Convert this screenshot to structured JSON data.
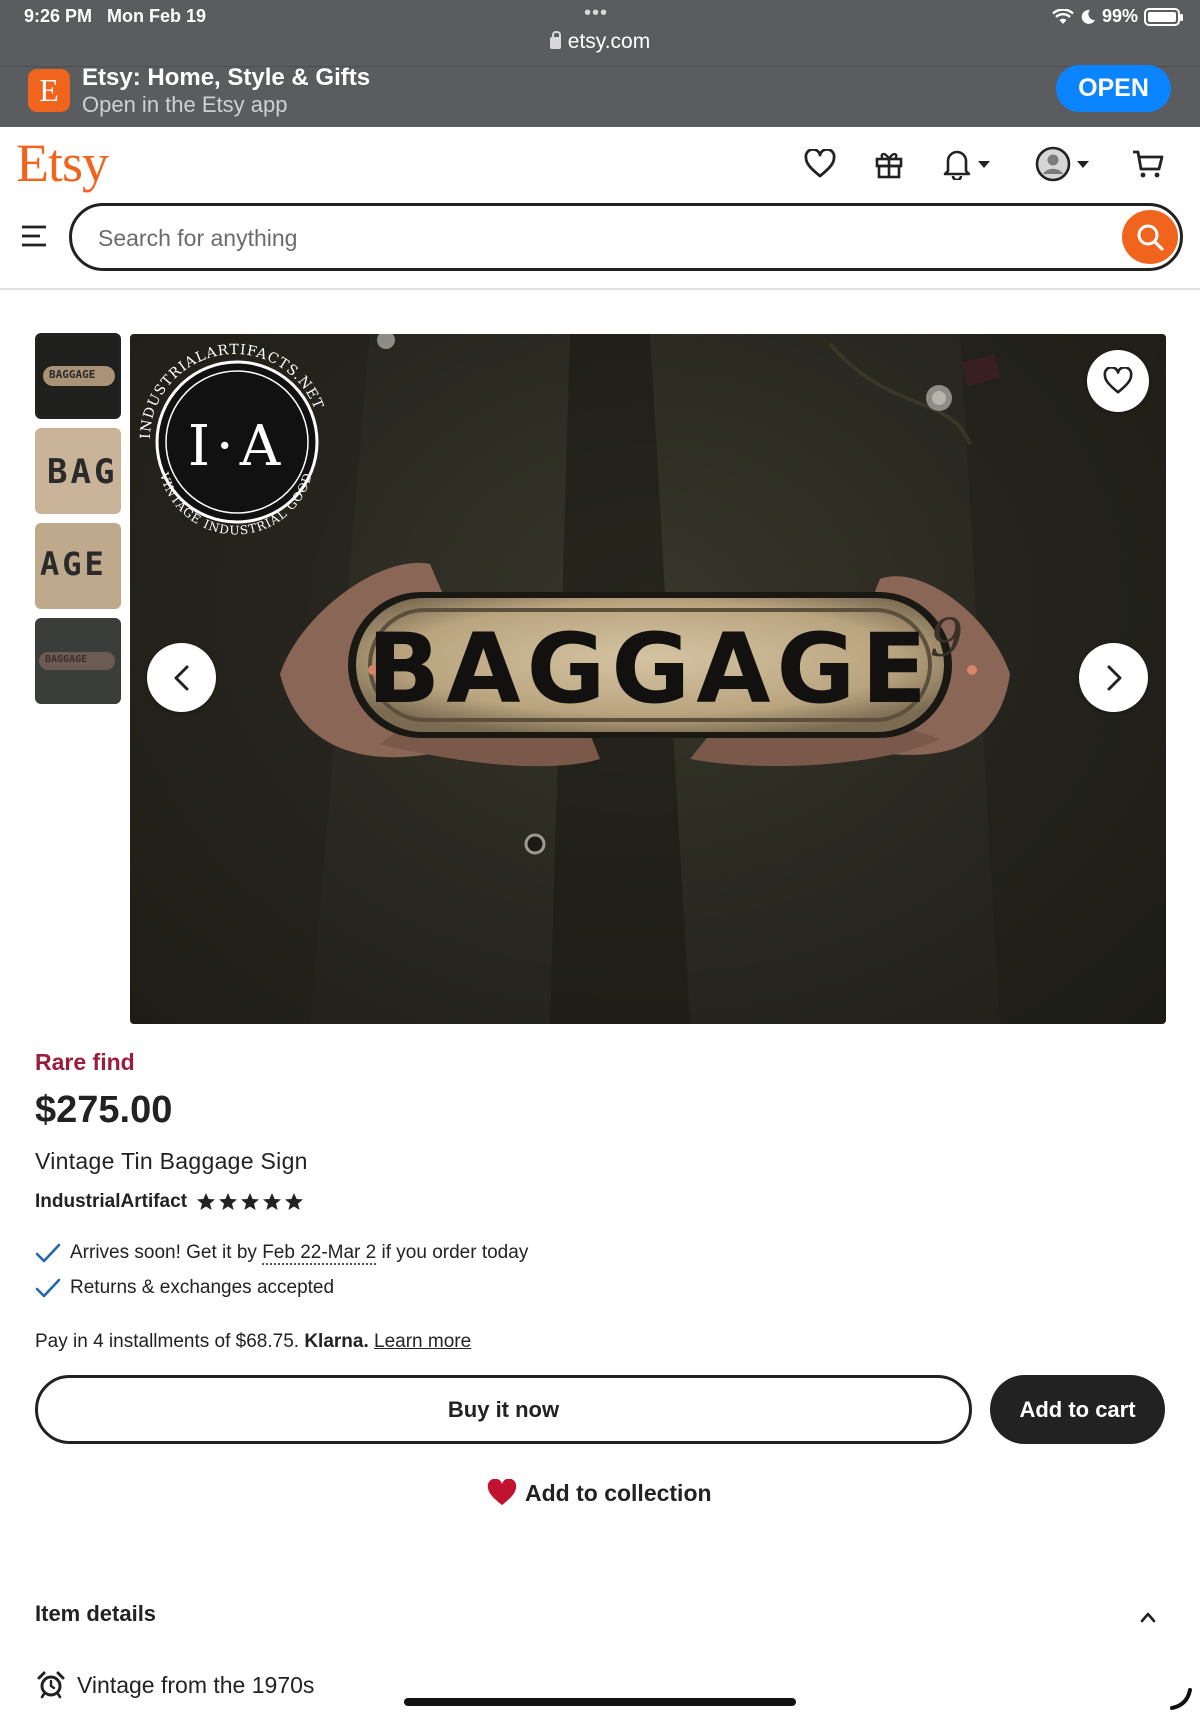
{
  "status_bar": {
    "time": "9:26 PM",
    "date": "Mon Feb 19",
    "dots": "•••",
    "battery": "99%",
    "battery_level": 0.99,
    "icons": [
      "wifi-icon",
      "moon-icon",
      "battery-icon"
    ]
  },
  "browser": {
    "url": "etsy.com"
  },
  "app_banner": {
    "logo_letter": "E",
    "title": "Etsy: Home, Style & Gifts",
    "subtitle": "Open in the Etsy app",
    "open_label": "OPEN"
  },
  "header": {
    "logo": "Etsy",
    "icons": [
      "favorites-heart-icon",
      "gift-icon",
      "notifications-bell-icon",
      "account-avatar-icon",
      "cart-icon"
    ],
    "search_placeholder": "Search for anything",
    "search_value": ""
  },
  "gallery": {
    "thumbnails": [
      {
        "text": "BAGGAGE"
      },
      {
        "text": "BAG"
      },
      {
        "text": "AGE"
      },
      {
        "text": "BAGGAGE"
      }
    ],
    "main_image": {
      "sign_text": "BAGGAGE",
      "sign_mark": "9",
      "watermark_initials": "I·A",
      "watermark_top_text": "INDUSTRIALARTIFACTS.NET",
      "watermark_bottom_text": "VINTAGE INDUSTRIAL GOODS"
    }
  },
  "listing": {
    "badge": "Rare find",
    "price": "$275.00",
    "title": "Vintage Tin Baggage Sign",
    "shop_name": "IndustrialArtifact",
    "rating_stars": 5,
    "delivery_prefix": "Arrives soon! Get it by ",
    "delivery_dates": "Feb 22-Mar 2",
    "delivery_suffix": " if you order today",
    "returns": "Returns & exchanges accepted",
    "klarna_text": "Pay in 4 installments of $68.75. ",
    "klarna_brand": "Klarna.",
    "klarna_link": "Learn more",
    "buy_now_label": "Buy it now",
    "add_to_cart_label": "Add to cart",
    "add_to_collection_label": "Add to collection"
  },
  "item_details": {
    "heading": "Item details",
    "vintage_text": "Vintage from the 1970s"
  },
  "colors": {
    "etsy_orange": "#f1641e",
    "rare_find": "#9c1c3c",
    "collection_heart": "#c1122f",
    "check_blue": "#2466ae",
    "ios_blue": "#0a84ff"
  }
}
